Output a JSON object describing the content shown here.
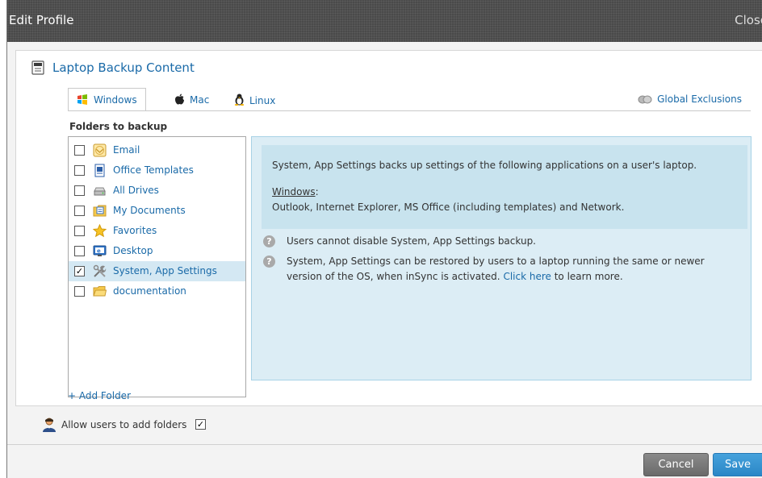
{
  "window": {
    "title": "Edit Profile",
    "close_label": "Close"
  },
  "section": {
    "title": "Laptop Backup Content"
  },
  "tabs": [
    {
      "label": "Windows",
      "active": true
    },
    {
      "label": "Mac",
      "active": false
    },
    {
      "label": "Linux",
      "active": false
    }
  ],
  "global_exclusions_label": "Global Exclusions",
  "folders": {
    "label": "Folders to backup",
    "items": [
      {
        "label": "Email",
        "checked": false,
        "icon": "email-icon"
      },
      {
        "label": "Office Templates",
        "checked": false,
        "icon": "office-templates-icon"
      },
      {
        "label": "All Drives",
        "checked": false,
        "icon": "drive-icon"
      },
      {
        "label": "My Documents",
        "checked": false,
        "icon": "documents-icon"
      },
      {
        "label": "Favorites",
        "checked": false,
        "icon": "star-icon"
      },
      {
        "label": "Desktop",
        "checked": false,
        "icon": "desktop-icon"
      },
      {
        "label": "System, App Settings",
        "checked": true,
        "selected": true,
        "icon": "tools-icon"
      },
      {
        "label": "documentation",
        "checked": false,
        "icon": "folder-icon"
      }
    ],
    "add_label": "+ Add Folder"
  },
  "info": {
    "description": "System, App Settings backs up settings of the following applications on a user's laptop.",
    "windows_heading": "Windows",
    "windows_colon": ":",
    "windows_apps": "Outlook, Internet Explorer, MS Office (including templates) and Network.",
    "note1": "Users cannot disable System, App Settings backup.",
    "note2_prefix": "System, App Settings can be restored by users to a laptop running the same or newer version of the OS, when inSync is activated. ",
    "note2_link": "Click here",
    "note2_suffix": " to learn more."
  },
  "allow_users": {
    "label": "Allow users to add folders",
    "checked": true
  },
  "footer": {
    "cancel_label": "Cancel",
    "save_label": "Save"
  },
  "colors": {
    "accent": "#1a6aa8",
    "save": "#2a86c6",
    "cancel": "#7a7a7a",
    "selected_row": "#d4e8f3",
    "info_bg": "#dcedf5"
  }
}
